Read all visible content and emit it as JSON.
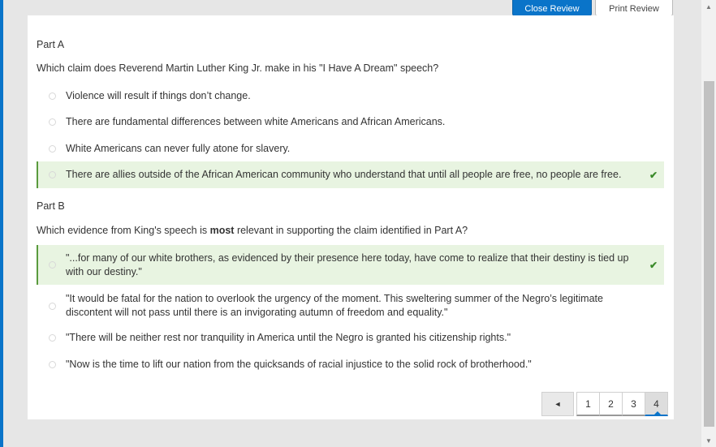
{
  "header": {
    "close_review": "Close Review",
    "print_review": "Print Review"
  },
  "partA": {
    "label": "Part A",
    "question": "Which claim does Reverend Martin Luther King Jr. make in his \"I Have A Dream\" speech?",
    "options": [
      "Violence will result if things don’t change.",
      "There are fundamental differences between white Americans and African Americans.",
      "White Americans can never fully atone for slavery.",
      "There are allies outside of the African American community who understand that until all people are free, no people are free."
    ],
    "correct_index": 3
  },
  "partB": {
    "label": "Part B",
    "question_before": "Which evidence from King's speech is ",
    "question_bold": "most",
    "question_after": " relevant in supporting the claim identified in Part A?",
    "options": [
      "\"...for many of our white brothers, as evidenced by their presence here today, have come to realize that their destiny is tied up with our destiny.\"",
      "\"It would be fatal for the nation to overlook the urgency of the moment. This sweltering summer of the Negro’s legitimate discontent will not pass until there is an invigorating autumn of freedom and equality.\"",
      "\"There will be neither rest nor tranquility in America until the Negro is granted his citizenship rights.\"",
      "\"Now is the time to lift our nation from the quicksands of racial injustice to the solid rock of brotherhood.\""
    ],
    "correct_index": 0
  },
  "pager": {
    "prev": "◄",
    "pages": [
      "1",
      "2",
      "3",
      "4"
    ],
    "active": "4"
  },
  "icons": {
    "check": "✔"
  },
  "colors": {
    "accent": "#0a74c9",
    "correct_bg": "#e8f4e1",
    "correct_bar": "#5a9a3d"
  }
}
